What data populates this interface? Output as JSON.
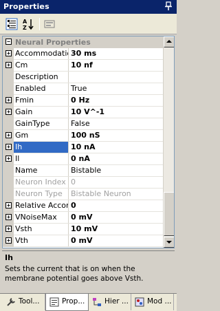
{
  "window": {
    "title": "Properties"
  },
  "toolbar": {
    "categorized_icon": "categorized-view-icon",
    "alphabetical_icon": "alphabetical-view-icon",
    "property_pages_icon": "property-pages-icon"
  },
  "grid": {
    "category": "Neural Properties",
    "rows": [
      {
        "expandable": true,
        "name": "Accommodation",
        "value": "30 ms",
        "bold": true,
        "readonly": false,
        "selected": false
      },
      {
        "expandable": true,
        "name": "Cm",
        "value": "10 nf",
        "bold": true,
        "readonly": false,
        "selected": false
      },
      {
        "expandable": false,
        "name": "Description",
        "value": "",
        "bold": false,
        "readonly": false,
        "selected": false
      },
      {
        "expandable": false,
        "name": "Enabled",
        "value": "True",
        "bold": false,
        "readonly": false,
        "selected": false
      },
      {
        "expandable": true,
        "name": "Fmin",
        "value": "0 Hz",
        "bold": true,
        "readonly": false,
        "selected": false
      },
      {
        "expandable": true,
        "name": "Gain",
        "value": "10 V^-1",
        "bold": true,
        "readonly": false,
        "selected": false
      },
      {
        "expandable": false,
        "name": "GainType",
        "value": "False",
        "bold": false,
        "readonly": false,
        "selected": false
      },
      {
        "expandable": true,
        "name": "Gm",
        "value": "100 nS",
        "bold": true,
        "readonly": false,
        "selected": false
      },
      {
        "expandable": true,
        "name": "Ih",
        "value": "10 nA",
        "bold": true,
        "readonly": false,
        "selected": true
      },
      {
        "expandable": true,
        "name": "Il",
        "value": "0 nA",
        "bold": true,
        "readonly": false,
        "selected": false
      },
      {
        "expandable": false,
        "name": "Name",
        "value": "Bistable",
        "bold": false,
        "readonly": false,
        "selected": false
      },
      {
        "expandable": false,
        "name": "Neuron Index",
        "value": "0",
        "bold": false,
        "readonly": true,
        "selected": false
      },
      {
        "expandable": false,
        "name": "Neuron Type",
        "value": "Bistable Neuron",
        "bold": false,
        "readonly": true,
        "selected": false
      },
      {
        "expandable": true,
        "name": "Relative Accom",
        "value": "0",
        "bold": true,
        "readonly": false,
        "selected": false
      },
      {
        "expandable": true,
        "name": "VNoiseMax",
        "value": "0 mV",
        "bold": true,
        "readonly": false,
        "selected": false
      },
      {
        "expandable": true,
        "name": "Vsth",
        "value": "10 mV",
        "bold": true,
        "readonly": false,
        "selected": false
      },
      {
        "expandable": true,
        "name": "Vth",
        "value": "0 mV",
        "bold": true,
        "readonly": false,
        "selected": false
      }
    ]
  },
  "description": {
    "title": "Ih",
    "text": "Sets the current that is on when the membrane potential goes above Vsth."
  },
  "tabs": [
    {
      "label": "Tool...",
      "icon": "wrench-icon",
      "active": false
    },
    {
      "label": "Prop...",
      "icon": "properties-icon",
      "active": true
    },
    {
      "label": "Hier ...",
      "icon": "hierarchy-icon",
      "active": false
    },
    {
      "label": "Mod ...",
      "icon": "modules-icon",
      "active": false
    }
  ],
  "colors": {
    "titlebar": "#0a246a",
    "selection": "#316ac5",
    "readonly_text": "#a0a0a0"
  }
}
